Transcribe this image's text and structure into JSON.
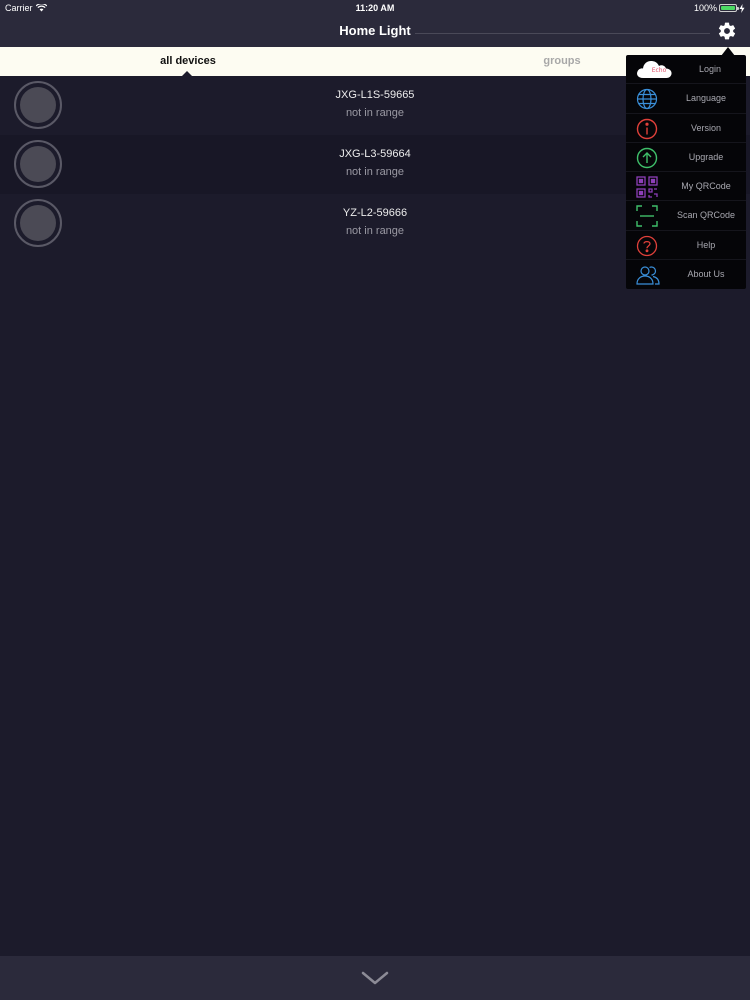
{
  "status_bar": {
    "carrier": "Carrier",
    "time": "11:20 AM",
    "battery": "100%",
    "battery_level": 1.0
  },
  "nav": {
    "title": "Home Light",
    "settings_icon": "gear-icon"
  },
  "tabs": [
    {
      "label": "all devices",
      "selected": true
    },
    {
      "label": "groups",
      "selected": false
    }
  ],
  "devices": [
    {
      "name": "JXG-L1S-59665",
      "status": "not in range"
    },
    {
      "name": "JXG-L3-59664",
      "status": "not in range"
    },
    {
      "name": "YZ-L2-59666",
      "status": "not in range"
    }
  ],
  "menu": {
    "cloud_logo_text": "Echo",
    "items": [
      {
        "label": "Login",
        "icon": "cloud-logo-icon"
      },
      {
        "label": "Language",
        "icon": "globe-icon",
        "color": "#3a8fd9"
      },
      {
        "label": "Version",
        "icon": "info-icon",
        "color": "#e0403a"
      },
      {
        "label": "Upgrade",
        "icon": "upload-arrow-icon",
        "color": "#3fbf6a"
      },
      {
        "label": "My QRCode",
        "icon": "qrcode-icon",
        "color": "#8d3fb8"
      },
      {
        "label": "Scan QRCode",
        "icon": "scan-frame-icon",
        "color": "#3fbf6a"
      },
      {
        "label": "Help",
        "icon": "help-icon",
        "color": "#e0403a"
      },
      {
        "label": "About Us",
        "icon": "people-icon",
        "color": "#3a8fd9"
      }
    ]
  },
  "bottom_bar": {
    "icon": "chevron-down-icon"
  },
  "colors": {
    "background": "#1c1b2b",
    "bar": "#2b2a3b",
    "tab_bar": "#fdfcf2",
    "menu": "#050508"
  }
}
